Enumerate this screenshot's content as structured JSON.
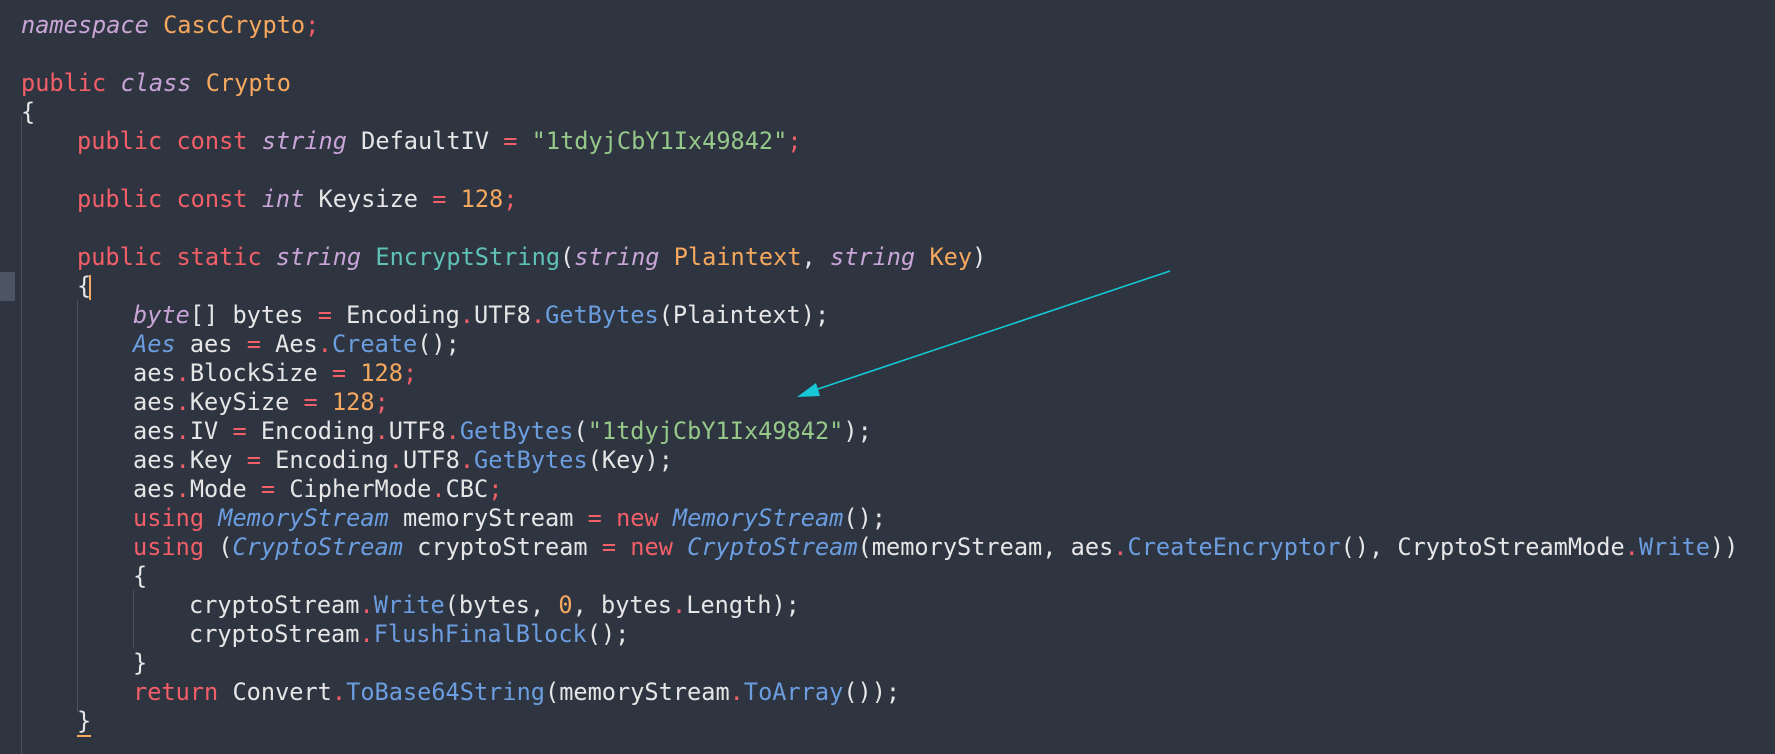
{
  "editor": {
    "lines": {
      "l1": {
        "kw": "namespace",
        "name": "CascCrypto",
        "end": ";"
      },
      "l3": {
        "mod": "public",
        "kw": "class",
        "name": "Crypto"
      },
      "l4": {
        "brace": "{"
      },
      "l5": {
        "mod1": "public",
        "mod2": "const",
        "type": "string",
        "name": "DefaultIV",
        "eq": "=",
        "value": "\"1tdyjCbY1Ix49842\"",
        "end": ";"
      },
      "l7": {
        "mod1": "public",
        "mod2": "const",
        "type": "int",
        "name": "Keysize",
        "eq": "=",
        "value": "128",
        "end": ";"
      },
      "l9": {
        "mod1": "public",
        "mod2": "static",
        "type": "string",
        "name": "EncryptString",
        "open": "(",
        "ptype1": "string",
        "pname1": "Plaintext",
        "comma": ",",
        "ptype2": "string",
        "pname2": "Key",
        "close": ")"
      },
      "l10": {
        "brace": "{"
      },
      "l11": {
        "type": "byte",
        "arr": "[]",
        "name": "bytes",
        "eq": "=",
        "obj": "Encoding",
        "dot1": ".",
        "prop": "UTF8",
        "dot2": ".",
        "fn": "GetBytes",
        "args": "(Plaintext);"
      },
      "l12": {
        "type": "Aes",
        "name": "aes",
        "eq": "=",
        "obj": "Aes",
        "dot": ".",
        "fn": "Create",
        "args": "();"
      },
      "l13": {
        "obj": "aes",
        "dot": ".",
        "prop": "BlockSize",
        "eq": "=",
        "value": "128",
        "end": ";"
      },
      "l14": {
        "obj": "aes",
        "dot": ".",
        "prop": "KeySize",
        "eq": "=",
        "value": "128",
        "end": ";"
      },
      "l15": {
        "obj": "aes",
        "dot": ".",
        "prop": "IV",
        "eq": "=",
        "cls": "Encoding",
        "dot1": ".",
        "prop2": "UTF8",
        "dot2": ".",
        "fn": "GetBytes",
        "open": "(",
        "value": "\"1tdyjCbY1Ix49842\"",
        "end": ");"
      },
      "l16": {
        "obj": "aes",
        "dot": ".",
        "prop": "Key",
        "eq": "=",
        "cls": "Encoding",
        "dot1": ".",
        "prop2": "UTF8",
        "dot2": ".",
        "fn": "GetBytes",
        "args": "(Key);"
      },
      "l17": {
        "obj": "aes",
        "dot": ".",
        "prop": "Mode",
        "eq": "=",
        "cls": "CipherMode",
        "dot1": ".",
        "prop2": "CBC",
        "end": ";"
      },
      "l18": {
        "kw": "using",
        "type": "MemoryStream",
        "name": "memoryStream",
        "eq": "=",
        "new": "new",
        "ctor": "MemoryStream",
        "end": "();"
      },
      "l19": {
        "kw": "using",
        "open": "(",
        "type": "CryptoStream",
        "name": "cryptoStream",
        "eq": "=",
        "new": "new",
        "ctor": "CryptoStream",
        "arg1": "(memoryStream, aes",
        "dot1": ".",
        "fn": "CreateEncryptor",
        "arg2": "(), CryptoStreamMode",
        "dot2": ".",
        "prop": "Write",
        "end": "))"
      },
      "l20": {
        "brace": "{"
      },
      "l21": {
        "obj": "cryptoStream",
        "dot": ".",
        "fn": "Write",
        "open": "(bytes, ",
        "num": "0",
        "mid": ", bytes",
        "dot2": ".",
        "prop": "Length",
        "end": ");"
      },
      "l22": {
        "obj": "cryptoStream",
        "dot": ".",
        "fn": "FlushFinalBlock",
        "end": "();"
      },
      "l23": {
        "brace": "}"
      },
      "l24": {
        "kw": "return",
        "cls": "Convert",
        "dot": ".",
        "fn": "ToBase64String",
        "open": "(memoryStream",
        "dot2": ".",
        "fn2": "ToArray",
        "end": "());"
      },
      "l25": {
        "brace": "}"
      }
    },
    "annotation": {
      "arrow_color": "#16c9d6"
    }
  }
}
